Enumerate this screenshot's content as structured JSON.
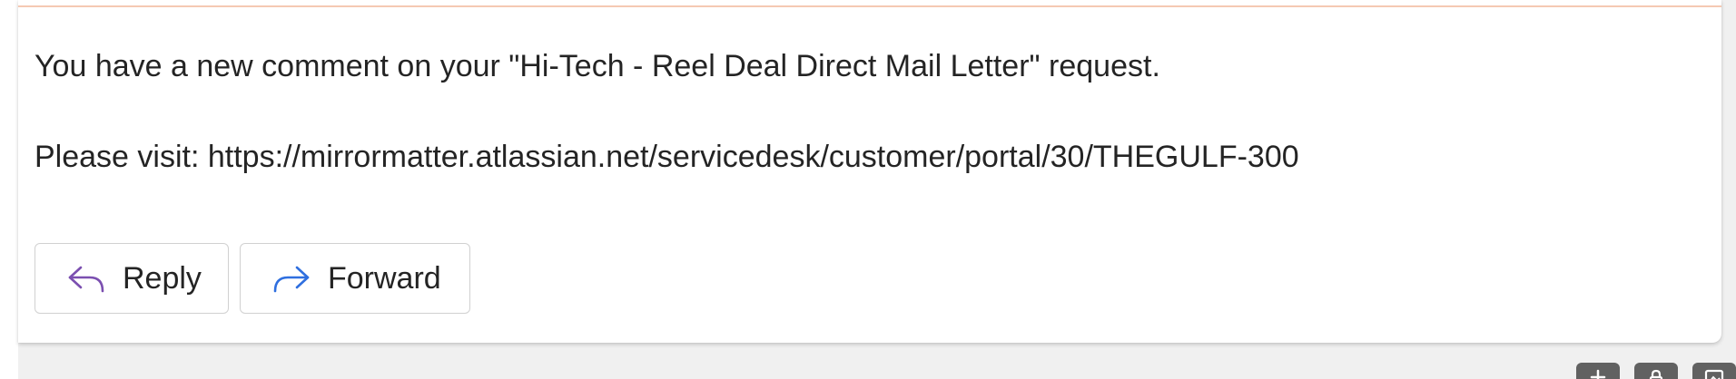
{
  "message": {
    "line1": "You have a new comment on your \"Hi-Tech - Reel Deal Direct Mail Letter\" request.",
    "line2": "Please visit: https://mirrormatter.atlassian.net/servicedesk/customer/portal/30/THEGULF-300"
  },
  "actions": {
    "reply_label": "Reply",
    "forward_label": "Forward",
    "reply_icon": "reply-arrow-icon",
    "forward_icon": "forward-arrow-icon"
  },
  "colors": {
    "reply_icon": "#7b4fb0",
    "forward_icon": "#2f6fdf",
    "accent_line": "#f5c9b3"
  },
  "bottom_toolbar": {
    "icons": [
      "add-icon",
      "lock-icon",
      "image-icon"
    ]
  }
}
